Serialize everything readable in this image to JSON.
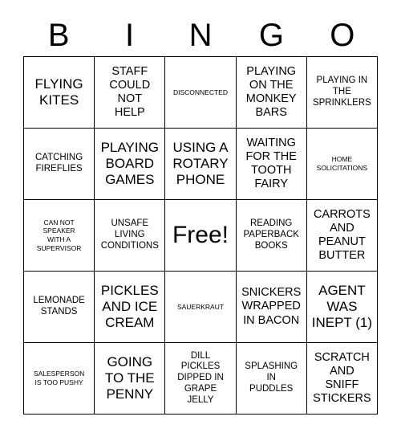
{
  "card": {
    "header_letters": [
      "B",
      "I",
      "N",
      "G",
      "O"
    ],
    "rows": [
      [
        {
          "text": "FLYING\nKITES",
          "size": "lg"
        },
        {
          "text": "STAFF\nCOULD\nNOT\nHELP",
          "size": "md"
        },
        {
          "text": "DISCONNECTED",
          "size": "xs"
        },
        {
          "text": "PLAYING\nON THE\nMONKEY\nBARS",
          "size": "md"
        },
        {
          "text": "PLAYING IN\nTHE\nSPRINKLERS",
          "size": "sm"
        }
      ],
      [
        {
          "text": "CATCHING\nFIREFLIES",
          "size": "sm"
        },
        {
          "text": "PLAYING\nBOARD\nGAMES",
          "size": "lg"
        },
        {
          "text": "USING A\nROTARY\nPHONE",
          "size": "lg"
        },
        {
          "text": "WAITING\nFOR THE\nTOOTH\nFAIRY",
          "size": "md"
        },
        {
          "text": "HOME\nSOLICITATIONS",
          "size": "xs"
        }
      ],
      [
        {
          "text": "CAN NOT\nSPEAKER\nWITH A\nSUPERVISOR",
          "size": "xs"
        },
        {
          "text": "UNSAFE\nLIVING\nCONDITIONS",
          "size": "sm"
        },
        {
          "text": "Free!",
          "size": "xl"
        },
        {
          "text": "READING\nPAPERBACK\nBOOKS",
          "size": "sm"
        },
        {
          "text": "CARROTS\nAND\nPEANUT\nBUTTER",
          "size": "md"
        }
      ],
      [
        {
          "text": "LEMONADE\nSTANDS",
          "size": "sm"
        },
        {
          "text": "PICKLES\nAND ICE\nCREAM",
          "size": "lg"
        },
        {
          "text": "SAUERKRAUT",
          "size": "xs"
        },
        {
          "text": "SNICKERS\nWRAPPED\nIN BACON",
          "size": "md"
        },
        {
          "text": "AGENT\nWAS\nINEPT (1)",
          "size": "lg"
        }
      ],
      [
        {
          "text": "SALESPERSON\nIS TOO PUSHY",
          "size": "xs"
        },
        {
          "text": "GOING\nTO THE\nPENNY",
          "size": "lg"
        },
        {
          "text": "DILL\nPICKLES\nDIPPED IN\nGRAPE\nJELLY",
          "size": "sm"
        },
        {
          "text": "SPLASHING\nIN\nPUDDLES",
          "size": "sm"
        },
        {
          "text": "SCRATCH\nAND\nSNIFF\nSTICKERS",
          "size": "md"
        }
      ]
    ]
  }
}
